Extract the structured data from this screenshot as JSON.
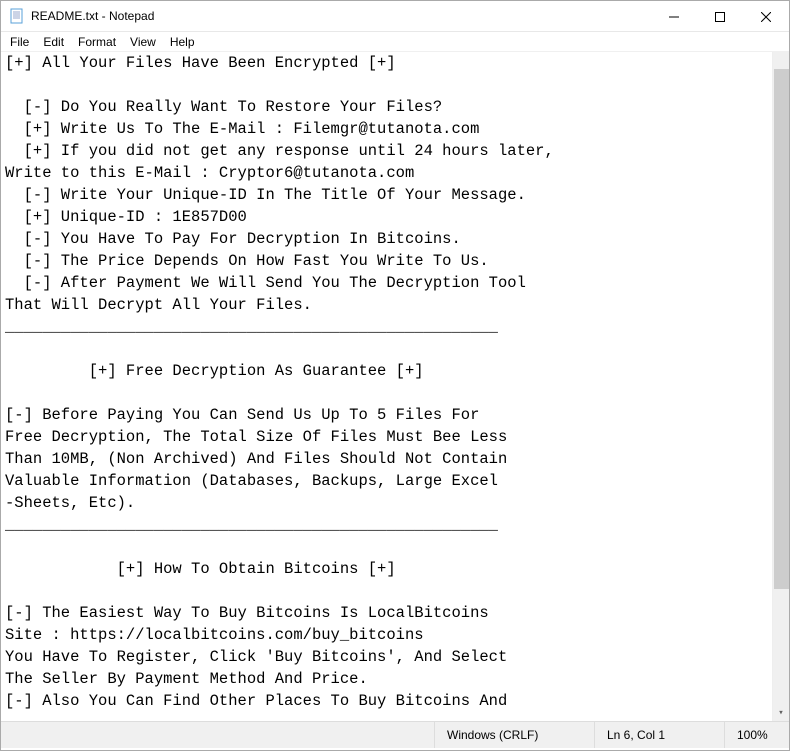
{
  "title": "README.txt - Notepad",
  "menu": {
    "file": "File",
    "edit": "Edit",
    "format": "Format",
    "view": "View",
    "help": "Help"
  },
  "body": "[+] All Your Files Have Been Encrypted [+]\n\n  [-] Do You Really Want To Restore Your Files?\n  [+] Write Us To The E-Mail : Filemgr@tutanota.com\n  [+] If you did not get any response until 24 hours later,\nWrite to this E-Mail : Cryptor6@tutanota.com\n  [-] Write Your Unique-ID In The Title Of Your Message.\n  [+] Unique-ID : 1E857D00\n  [-] You Have To Pay For Decryption In Bitcoins.\n  [-] The Price Depends On How Fast You Write To Us.\n  [-] After Payment We Will Send You The Decryption Tool\nThat Will Decrypt All Your Files.\n_____________________________________________________\n\n         [+] Free Decryption As Guarantee [+]\n\n[-] Before Paying You Can Send Us Up To 5 Files For\nFree Decryption, The Total Size Of Files Must Bee Less\nThan 10MB, (Non Archived) And Files Should Not Contain\nValuable Information (Databases, Backups, Large Excel\n-Sheets, Etc).\n_____________________________________________________\n\n            [+] How To Obtain Bitcoins [+]\n\n[-] The Easiest Way To Buy Bitcoins Is LocalBitcoins\nSite : https://localbitcoins.com/buy_bitcoins\nYou Have To Register, Click 'Buy Bitcoins', And Select\nThe Seller By Payment Method And Price.\n[-] Also You Can Find Other Places To Buy Bitcoins And",
  "status": {
    "lineending": "Windows (CRLF)",
    "position": "Ln 6, Col 1",
    "zoom": "100%"
  }
}
